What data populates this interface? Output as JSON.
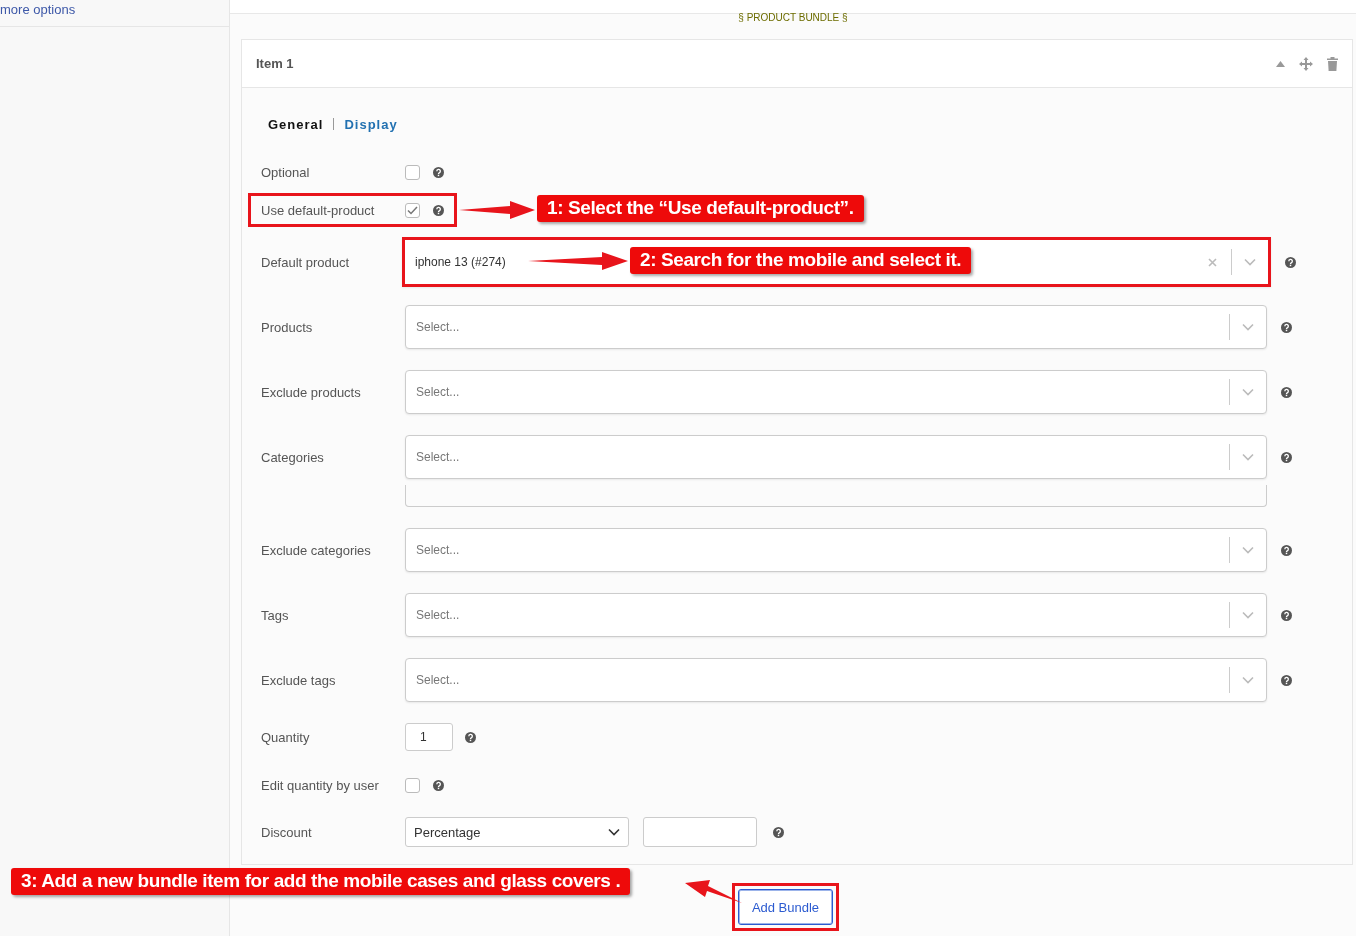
{
  "sidebar": {
    "link": "more options"
  },
  "section_title": "§ PRODUCT BUNDLE §",
  "item": {
    "title": "Item 1",
    "tabs": [
      {
        "label": "General",
        "selected": true
      },
      {
        "label": "Display",
        "selected": false
      }
    ],
    "fields": [
      {
        "kind": "checkbox",
        "label": "Optional",
        "checked": false,
        "highlighted": false
      },
      {
        "kind": "checkbox",
        "label": "Use default-product",
        "checked": true,
        "highlighted": true
      },
      {
        "kind": "select",
        "label": "Default product",
        "value": "iphone 13 (#274)",
        "clearable": true,
        "highlighted": true
      },
      {
        "kind": "select",
        "label": "Products",
        "placeholder": "Select...",
        "clearable": false,
        "highlighted": false
      },
      {
        "kind": "select",
        "label": "Exclude products",
        "placeholder": "Select...",
        "clearable": false,
        "highlighted": false
      },
      {
        "kind": "select",
        "label": "Categories",
        "placeholder": "Select...",
        "clearable": false,
        "highlighted": false
      },
      {
        "kind": "panel-edge"
      },
      {
        "kind": "select",
        "label": "Exclude categories",
        "placeholder": "Select...",
        "clearable": false,
        "highlighted": false
      },
      {
        "kind": "select",
        "label": "Tags",
        "placeholder": "Select...",
        "clearable": false,
        "highlighted": false
      },
      {
        "kind": "select",
        "label": "Exclude tags",
        "placeholder": "Select...",
        "clearable": false,
        "highlighted": false
      },
      {
        "kind": "number",
        "label": "Quantity",
        "value": "1"
      },
      {
        "kind": "checkbox",
        "label": "Edit quantity by user",
        "checked": false,
        "highlighted": false
      },
      {
        "kind": "discount",
        "label": "Discount",
        "value": "Percentage"
      }
    ]
  },
  "add_button": {
    "label": "Add Bundle",
    "highlighted": true
  },
  "annotations": [
    {
      "text": "1: Select the “Use default-product”."
    },
    {
      "text": "2:  Search for the mobile and select it."
    },
    {
      "text": "3: Add a new bundle item for add the mobile cases and glass covers ."
    }
  ]
}
